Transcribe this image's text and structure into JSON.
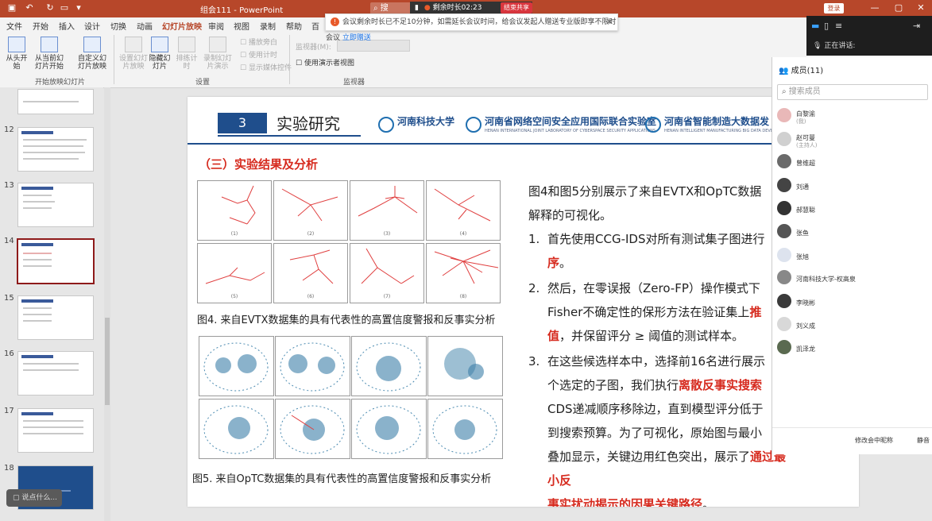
{
  "app": {
    "doc_title": "组会111",
    "app_name": "PowerPoint",
    "search_placeholder": "搜",
    "meeting_remaining": "剩余时长02:23",
    "end_share": "结束共享",
    "login": "登录"
  },
  "notification": {
    "text": "会议剩余时长已不足10分钟，如需延长会议时间，给会议发起人赠送专业版即享不限时会议",
    "link": "立即赠送"
  },
  "tabs": [
    "文件",
    "开始",
    "插入",
    "设计",
    "切换",
    "动画",
    "幻灯片放映",
    "审阅",
    "视图",
    "录制",
    "帮助",
    "百"
  ],
  "ribbon": {
    "from_start": "从头开始",
    "from_current": "从当前幻灯片开始",
    "custom": "自定义幻灯片放映",
    "group1": "开始放映幻灯片",
    "setup": "设置幻灯片放映",
    "hide": "隐藏幻灯片",
    "rehearse": "排练计时",
    "record": "录制幻灯片演示",
    "play_narr": "播放旁白",
    "use_timing": "使用计时",
    "show_media": "显示媒体控件",
    "group2": "设置",
    "monitor_label": "监视器(M):",
    "presenter_view": "使用演示者视图",
    "group3": "监视器"
  },
  "thumbnails": [
    "12",
    "13",
    "14",
    "15",
    "16",
    "17",
    "18"
  ],
  "type_hint": "说点什么...",
  "slide": {
    "section_num": "3",
    "title": "实验研究",
    "logo1": "河南科技大学",
    "logo2": "河南省网络空间安全应用国际联合实验室",
    "logo2_en": "HENAN INTERNATIONAL JOINT LABORATORY OF CYBERSPACE SECURITY APPLICATIONS",
    "logo3": "河南省智能制造大数据发",
    "logo3_en": "HENAN INTELLIGENT MANUFACTURING BIG DATA DEVEL",
    "subheading": "（三）实验结果及分析",
    "fig_labels": [
      "(1)",
      "(2)",
      "(3)",
      "(4)",
      "(5)",
      "(6)",
      "(7)",
      "(8)"
    ],
    "cap4": "图4. 来自EVTX数据集的具有代表性的高置信度警报和反事实分析",
    "cap5": "图5. 来自OpTC数据集的具有代表性的高置信度警报和反事实分析",
    "intro_a": "图4和图5分别展示了来自EVTX和OpTC数据",
    "intro_b": "解释的可视化。",
    "item1_num": "1.",
    "item1_a": "首先使用CCG-IDS对所有测试集子图进行",
    "item1_red": "序",
    "item1_b": "。",
    "item2_num": "2.",
    "item2_a": "然后，在零误报（Zero-FP）操作模式下",
    "item2_b": "Fisher不确定性的保形方法在验证集上",
    "item2_red1": "推",
    "item2_red2": "值",
    "item2_c": "，并保留评分 ≥ 阈值的测试样本。",
    "item3_num": "3.",
    "item3_a": "在这些候选样本中，选择前16名进行展示",
    "item3_b": "个选定的子图，我们执行",
    "item3_red1": "离散反事实搜索",
    "item3_c": "CDS递减顺序移除边，直到模型评分低于",
    "item3_d": "到搜索预算。为了可视化，原始图与最小",
    "item3_e": "叠加显示，关键边用红色突出，展示了",
    "item3_red2": "通过最小反",
    "item3_red3": "事实扰动揭示的因果关键路径",
    "item3_end": "。"
  },
  "meeting": {
    "speaking": "正在讲话:",
    "members_title": "成员(11)",
    "search_placeholder": "搜索成员",
    "members": [
      {
        "name": "白黎渝",
        "status": "(我)"
      },
      {
        "name": "赵可曼",
        "status": "(主持人)"
      },
      {
        "name": "曾维超",
        "status": ""
      },
      {
        "name": "刘通",
        "status": ""
      },
      {
        "name": "郝慧聪",
        "status": ""
      },
      {
        "name": "张鱼",
        "status": ""
      },
      {
        "name": "张旭",
        "status": ""
      },
      {
        "name": "河南科技大学-权高泉",
        "status": ""
      },
      {
        "name": "李晓彬",
        "status": ""
      },
      {
        "name": "刘义成",
        "status": ""
      },
      {
        "name": "凯泽龙",
        "status": ""
      }
    ],
    "edit_name": "修改会中昵称",
    "mute": "静音"
  },
  "colors": {
    "ppt_red": "#b7472a",
    "title_blue": "#1f4e8c",
    "accent_red": "#d62a1e"
  }
}
